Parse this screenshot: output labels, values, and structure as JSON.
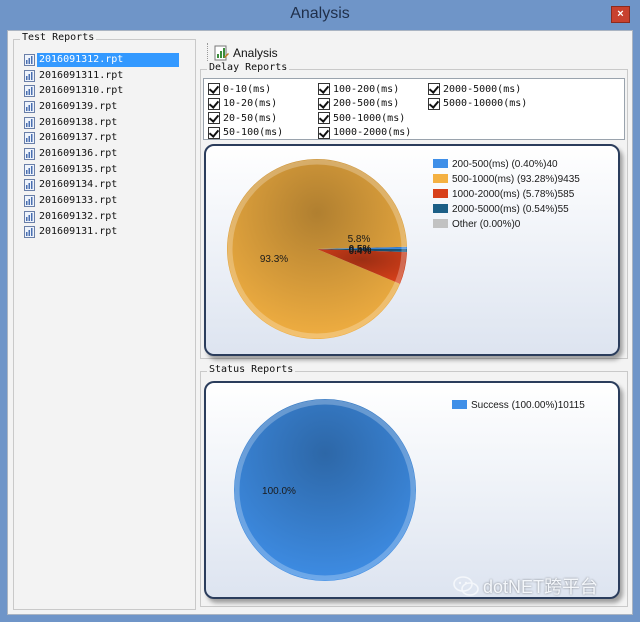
{
  "window": {
    "title": "Analysis",
    "close_glyph": "×"
  },
  "test_reports": {
    "title": "Test Reports",
    "files": [
      {
        "name": "2016091312.rpt",
        "selected": true
      },
      {
        "name": "2016091311.rpt"
      },
      {
        "name": "2016091310.rpt"
      },
      {
        "name": "201609139.rpt"
      },
      {
        "name": "201609138.rpt"
      },
      {
        "name": "201609137.rpt"
      },
      {
        "name": "201609136.rpt"
      },
      {
        "name": "201609135.rpt"
      },
      {
        "name": "201609134.rpt"
      },
      {
        "name": "201609133.rpt"
      },
      {
        "name": "201609132.rpt"
      },
      {
        "name": "201609131.rpt"
      }
    ]
  },
  "toolbar": {
    "analysis_label": "Analysis",
    "analysis_icon": "chart-document-icon"
  },
  "delay_reports": {
    "title": "Delay  Reports",
    "checkboxes": [
      {
        "label": "0-10(ms)",
        "checked": true
      },
      {
        "label": "10-20(ms)",
        "checked": true
      },
      {
        "label": "20-50(ms)",
        "checked": true
      },
      {
        "label": "50-100(ms)",
        "checked": true
      },
      {
        "label": "100-200(ms)",
        "checked": true
      },
      {
        "label": "200-500(ms)",
        "checked": true
      },
      {
        "label": "500-1000(ms)",
        "checked": true
      },
      {
        "label": "1000-2000(ms)",
        "checked": true
      },
      {
        "label": "2000-5000(ms)",
        "checked": true
      },
      {
        "label": "5000-10000(ms)",
        "checked": true
      }
    ]
  },
  "status_reports": {
    "title": "Status Reports"
  },
  "chart_data": [
    {
      "type": "pie",
      "slices": [
        {
          "label": "200-500(ms) (0.40%)40",
          "value": 40,
          "color": "#3f8fe8"
        },
        {
          "label": "500-1000(ms) (93.28%)9435",
          "value": 9435,
          "color": "#f4b142"
        },
        {
          "label": "1000-2000(ms) (5.78%)585",
          "value": 585,
          "color": "#d8401a"
        },
        {
          "label": "2000-5000(ms) (0.54%)55",
          "value": 55,
          "color": "#1c5f86"
        },
        {
          "label": "Other (0.00%)0",
          "value": 0,
          "color": "#c2c2c2"
        }
      ],
      "data_labels": [
        {
          "text": "93.3%"
        },
        {
          "text": "5.8%"
        },
        {
          "text": "0.5%"
        },
        {
          "text": "0.4%"
        }
      ],
      "legend": "top-right"
    },
    {
      "type": "pie",
      "slices": [
        {
          "label": "Success (100.00%)10115",
          "value": 10115,
          "color": "#3f8fe8"
        }
      ],
      "data_labels": [
        {
          "text": "100.0%"
        }
      ],
      "legend": "top-right"
    }
  ],
  "watermark": {
    "text": "dotNET跨平台",
    "icon": "wechat-icon"
  }
}
